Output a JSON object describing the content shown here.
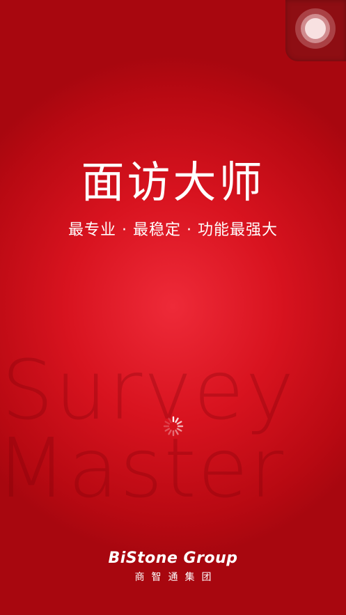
{
  "splash": {
    "title": "面访大师",
    "tagline": "最专业 · 最稳定 · 功能最强大",
    "watermark_line1": "Survey",
    "watermark_line2": "Master",
    "brand": "BiStone Group",
    "brand_cn": "商智通集团"
  },
  "overlay": {
    "assistive_touch_icon": "assistive-touch-icon"
  },
  "loading": {
    "icon": "loading-spinner-icon"
  },
  "colors": {
    "background": "#d8131f",
    "background_center": "#ee2a38",
    "text": "#ffffff"
  }
}
